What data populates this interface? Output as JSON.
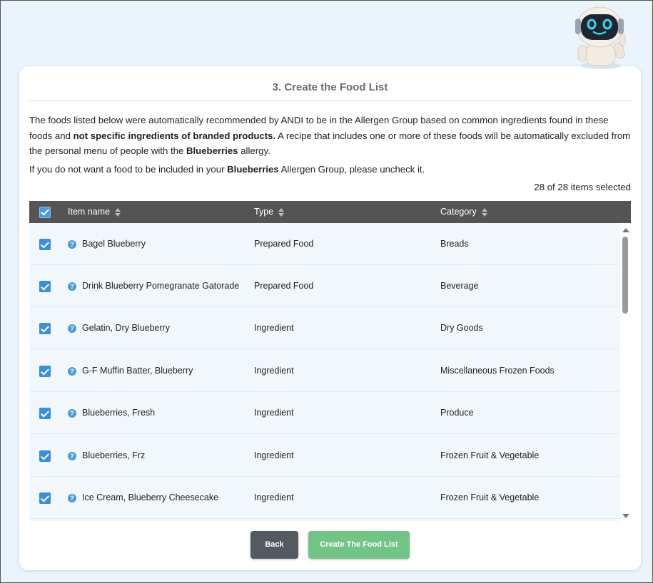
{
  "card": {
    "title": "3. Create the Food List",
    "desc_part1": "The foods listed below were automatically recommended by ANDI to be in the Allergen Group based on common ingredients found in these foods and ",
    "desc_bold1": "not specific ingredients of branded products.",
    "desc_part2": " A recipe that includes one or more of these foods will be automatically excluded from the personal menu of people with the ",
    "desc_bold2": "Blueberries",
    "desc_part3": " allergy.",
    "uncheck_part1": "If you do not want a food to be included in your ",
    "uncheck_bold": "Blueberries",
    "uncheck_part2": " Allergen Group, please uncheck it.",
    "selection_count": "28 of 28 items selected"
  },
  "table": {
    "columns": [
      "Item name",
      "Type",
      "Category"
    ],
    "rows": [
      {
        "name": "Bagel Blueberry",
        "type": "Prepared Food",
        "category": "Breads",
        "checked": true
      },
      {
        "name": "Drink Blueberry Pomegranate Gatorade",
        "type": "Prepared Food",
        "category": "Beverage",
        "checked": true
      },
      {
        "name": "Gelatin, Dry Blueberry",
        "type": "Ingredient",
        "category": "Dry Goods",
        "checked": true
      },
      {
        "name": "G-F Muffin Batter, Blueberry",
        "type": "Ingredient",
        "category": "Miscellaneous Frozen Foods",
        "checked": true
      },
      {
        "name": "Blueberries, Fresh",
        "type": "Ingredient",
        "category": "Produce",
        "checked": true
      },
      {
        "name": "Blueberries, Frz",
        "type": "Ingredient",
        "category": "Frozen Fruit & Vegetable",
        "checked": true
      },
      {
        "name": "Ice Cream, Blueberry Cheesecake",
        "type": "Ingredient",
        "category": "Frozen Fruit & Vegetable",
        "checked": true
      }
    ]
  },
  "buttons": {
    "back": "Back",
    "create": "Create The Food List"
  },
  "icons": {
    "assistant": "robot-mascot-icon",
    "info": "question-icon",
    "sort": "sort-icon",
    "checkbox": "checkbox-checked-icon"
  },
  "colors": {
    "header_bg": "#545454",
    "checkbox": "#3b8fd6",
    "back_button": "#545a61",
    "create_button": "#71c485",
    "page_bg": "#ebf4fc"
  }
}
